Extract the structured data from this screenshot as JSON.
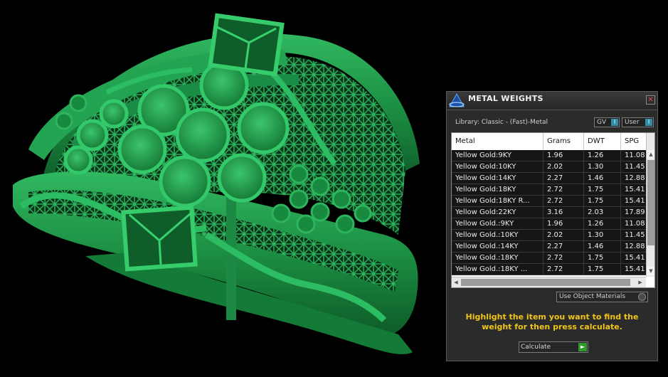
{
  "panel": {
    "title": "METAL WEIGHTS",
    "close_label": "✕",
    "library_label": "Library: Classic - (Fast)-Metal",
    "gv_label": "GV",
    "user_label": "User",
    "toggle_knob": "I",
    "use_materials_label": "Use Object Materials",
    "instruction": "Highlight the item you want to find the weight for then press calculate.",
    "calculate_label": "Calculate",
    "calculate_icon": "►"
  },
  "table": {
    "columns": [
      "Metal",
      "Grams",
      "DWT",
      "SPG"
    ],
    "rows": [
      [
        "Yellow Gold:9KY",
        "1.96",
        "1.26",
        "11.08"
      ],
      [
        "Yellow Gold:10KY",
        "2.02",
        "1.30",
        "11.45"
      ],
      [
        "Yellow Gold:14KY",
        "2.27",
        "1.46",
        "12.88"
      ],
      [
        "Yellow Gold:18KY",
        "2.72",
        "1.75",
        "15.41"
      ],
      [
        "Yellow Gold:18KY R...",
        "2.72",
        "1.75",
        "15.41"
      ],
      [
        "Yellow Gold:22KY",
        "3.16",
        "2.03",
        "17.89"
      ],
      [
        "Yellow Gold.:9KY",
        "1.96",
        "1.26",
        "11.08"
      ],
      [
        "Yellow Gold.:10KY",
        "2.02",
        "1.30",
        "11.45"
      ],
      [
        "Yellow Gold.:14KY",
        "2.27",
        "1.46",
        "12.88"
      ],
      [
        "Yellow Gold.:18KY",
        "2.72",
        "1.75",
        "15.41"
      ],
      [
        "Yellow Gold.:18KY ...",
        "2.72",
        "1.75",
        "15.41"
      ]
    ]
  },
  "colors": {
    "model_green": "#1f9e4a",
    "instruction_yellow": "#f0c419",
    "toggle_blue": "#2f8fa6",
    "calc_green": "#2f9a2f"
  },
  "icons": {
    "logo": "app-logo-icon",
    "close": "close-icon",
    "calculate": "play-arrow-icon"
  }
}
